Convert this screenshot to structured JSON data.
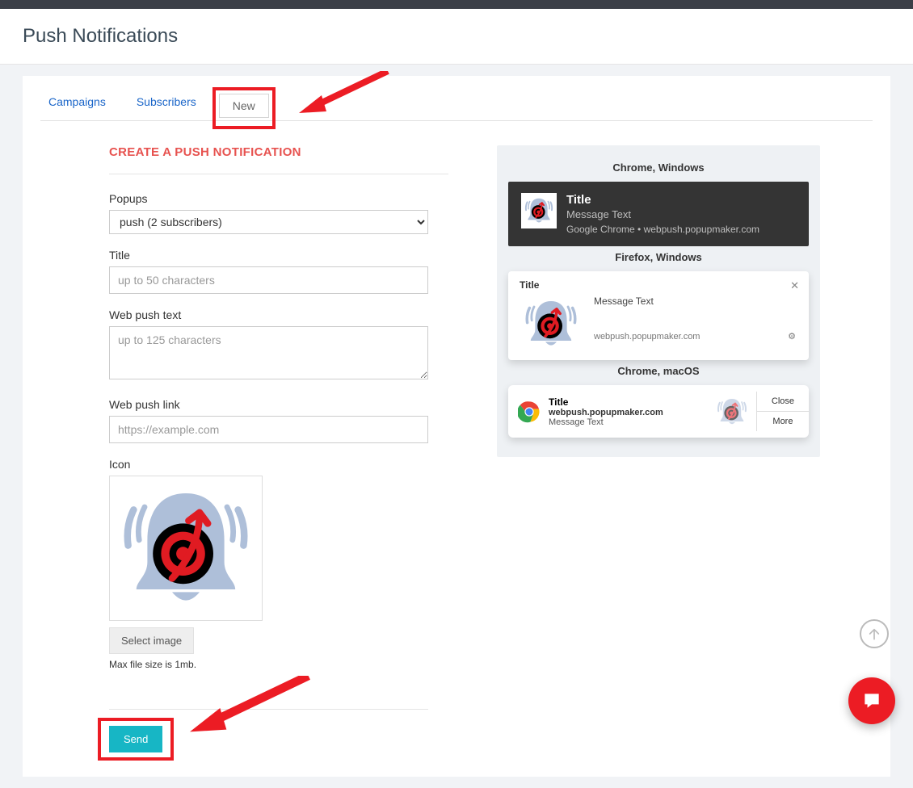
{
  "page": {
    "title": "Push Notifications"
  },
  "tabs": {
    "campaigns": "Campaigns",
    "subscribers": "Subscribers",
    "new": "New"
  },
  "form": {
    "header": "CREATE A PUSH NOTIFICATION",
    "popups_label": "Popups",
    "popups_value": "push (2 subscribers)",
    "title_label": "Title",
    "title_placeholder": "up to 50 characters",
    "text_label": "Web push text",
    "text_placeholder": "up to 125 characters",
    "link_label": "Web push link",
    "link_placeholder": "https://example.com",
    "icon_label": "Icon",
    "select_image": "Select image",
    "hint": "Max file size is 1mb.",
    "send": "Send"
  },
  "previews": {
    "chrome_win_label": "Chrome, Windows",
    "chrome_win": {
      "title": "Title",
      "msg": "Message Text",
      "src": "Google Chrome • webpush.popupmaker.com"
    },
    "firefox_win_label": "Firefox, Windows",
    "firefox_win": {
      "title": "Title",
      "msg": "Message Text",
      "src": "webpush.popupmaker.com"
    },
    "chrome_mac_label": "Chrome, macOS",
    "chrome_mac": {
      "title": "Title",
      "src": "webpush.popupmaker.com",
      "msg": "Message Text",
      "close": "Close",
      "more": "More"
    }
  }
}
